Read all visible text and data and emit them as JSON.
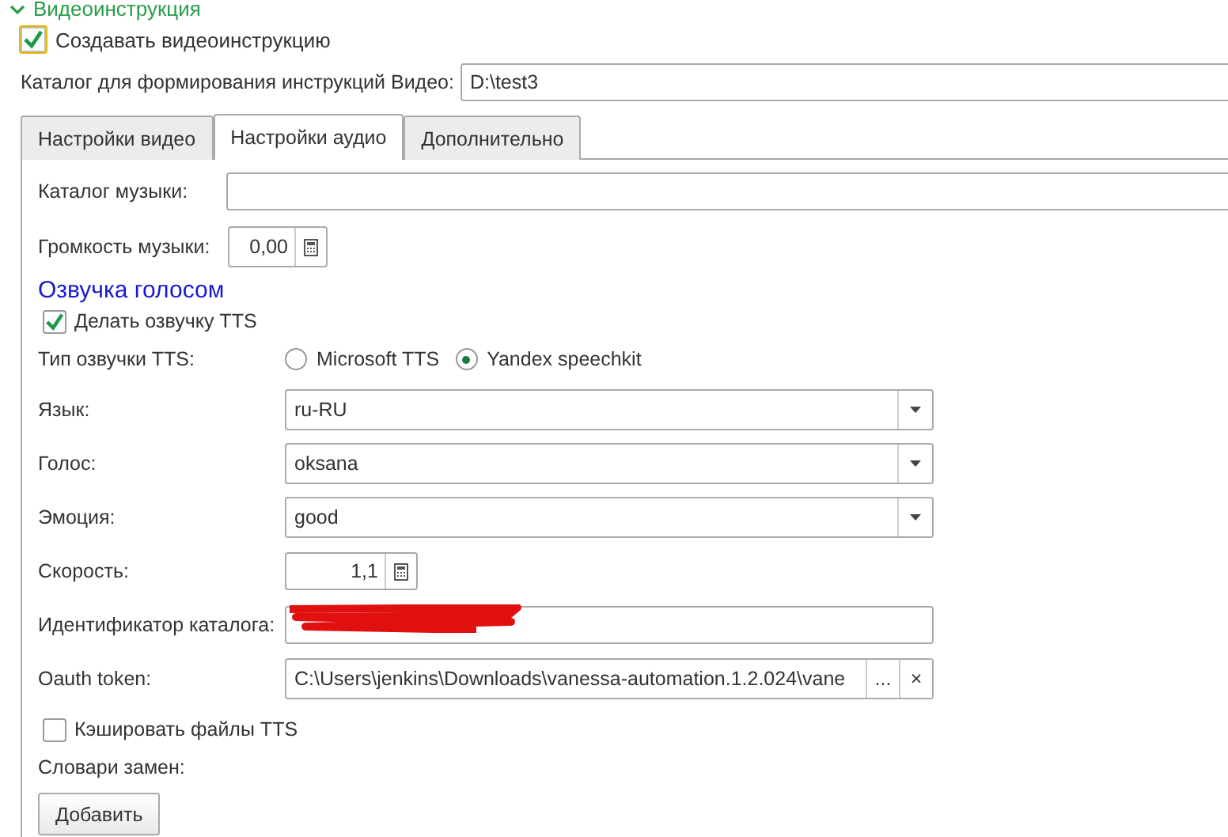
{
  "section": {
    "title": "Видеоинструкция",
    "expanded": true
  },
  "create_video": {
    "label": "Создавать видеоинструкцию",
    "checked": true
  },
  "video_catalog": {
    "label": "Каталог для формирования инструкций Видео:",
    "value": "D:\\test3"
  },
  "tabs": [
    {
      "label": "Настройки видео",
      "selected": false
    },
    {
      "label": "Настройки аудио",
      "selected": true
    },
    {
      "label": "Дополнительно",
      "selected": false
    }
  ],
  "music_catalog": {
    "label": "Каталог музыки:"
  },
  "music_volume": {
    "label": "Громкость музыки:",
    "value": "0,00"
  },
  "voice_heading": "Озвучка голосом",
  "tts_enabled": {
    "label": "Делать озвучку TTS",
    "checked": true
  },
  "tts_type": {
    "label": "Тип озвучки TTS:",
    "options": [
      {
        "label": "Microsoft TTS",
        "selected": false
      },
      {
        "label": "Yandex speechkit",
        "selected": true
      }
    ]
  },
  "fields": [
    {
      "kind": "dropdown",
      "label": "Язык:",
      "value": "ru-RU"
    },
    {
      "kind": "dropdown",
      "label": "Голос:",
      "value": "oksana"
    },
    {
      "kind": "dropdown",
      "label": "Эмоция:",
      "value": "good"
    },
    {
      "kind": "number",
      "label": "Скорость:",
      "value": "1,1"
    },
    {
      "kind": "redacted",
      "label": "Идентификатор каталога:"
    },
    {
      "kind": "file",
      "label": "Oauth token:",
      "value": "C:\\Users\\jenkins\\Downloads\\vanessa-automation.1.2.024\\vane",
      "choose_button": "...",
      "clear_button": "×"
    }
  ],
  "cache_tts": {
    "label": "Кэшировать файлы TTS",
    "checked": false
  },
  "replacements": {
    "label": "Словари замен:",
    "add_button": "Добавить"
  }
}
